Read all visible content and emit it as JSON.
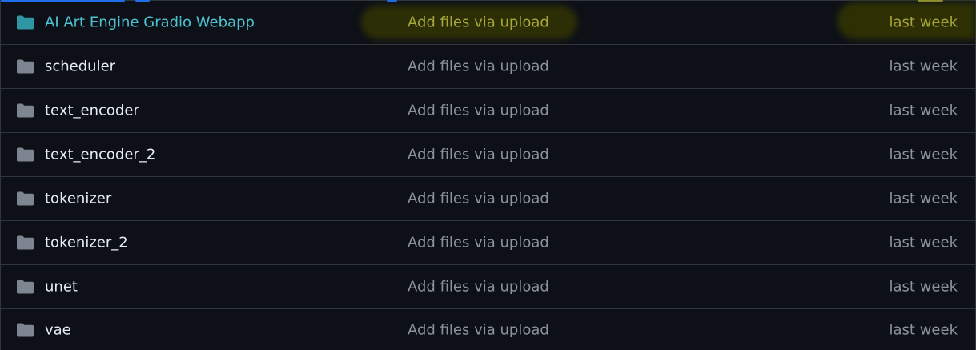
{
  "file_list": {
    "rows": [
      {
        "name": "AI Art Engine Gradio Webapp",
        "commit": "Add files via upload",
        "age": "last week",
        "highlighted": true
      },
      {
        "name": "scheduler",
        "commit": "Add files via upload",
        "age": "last week",
        "highlighted": false
      },
      {
        "name": "text_encoder",
        "commit": "Add files via upload",
        "age": "last week",
        "highlighted": false
      },
      {
        "name": "text_encoder_2",
        "commit": "Add files via upload",
        "age": "last week",
        "highlighted": false
      },
      {
        "name": "tokenizer",
        "commit": "Add files via upload",
        "age": "last week",
        "highlighted": false
      },
      {
        "name": "tokenizer_2",
        "commit": "Add files via upload",
        "age": "last week",
        "highlighted": false
      },
      {
        "name": "unet",
        "commit": "Add files via upload",
        "age": "last week",
        "highlighted": false
      },
      {
        "name": "vae",
        "commit": "Add files via upload",
        "age": "last week",
        "highlighted": false
      }
    ]
  },
  "icons": {
    "folder": "folder-icon"
  },
  "colors": {
    "background": "#0d1117",
    "border": "#30363d",
    "folder_default": "#7d8590",
    "folder_highlight": "#2f97a4",
    "name_text": "#e6edf3",
    "name_highlight": "#4fc3d4",
    "muted_text": "#8b949e",
    "highlight_text": "#a7a63a",
    "highlight_background": "#363700",
    "accent_blue": "#1f6feb"
  }
}
